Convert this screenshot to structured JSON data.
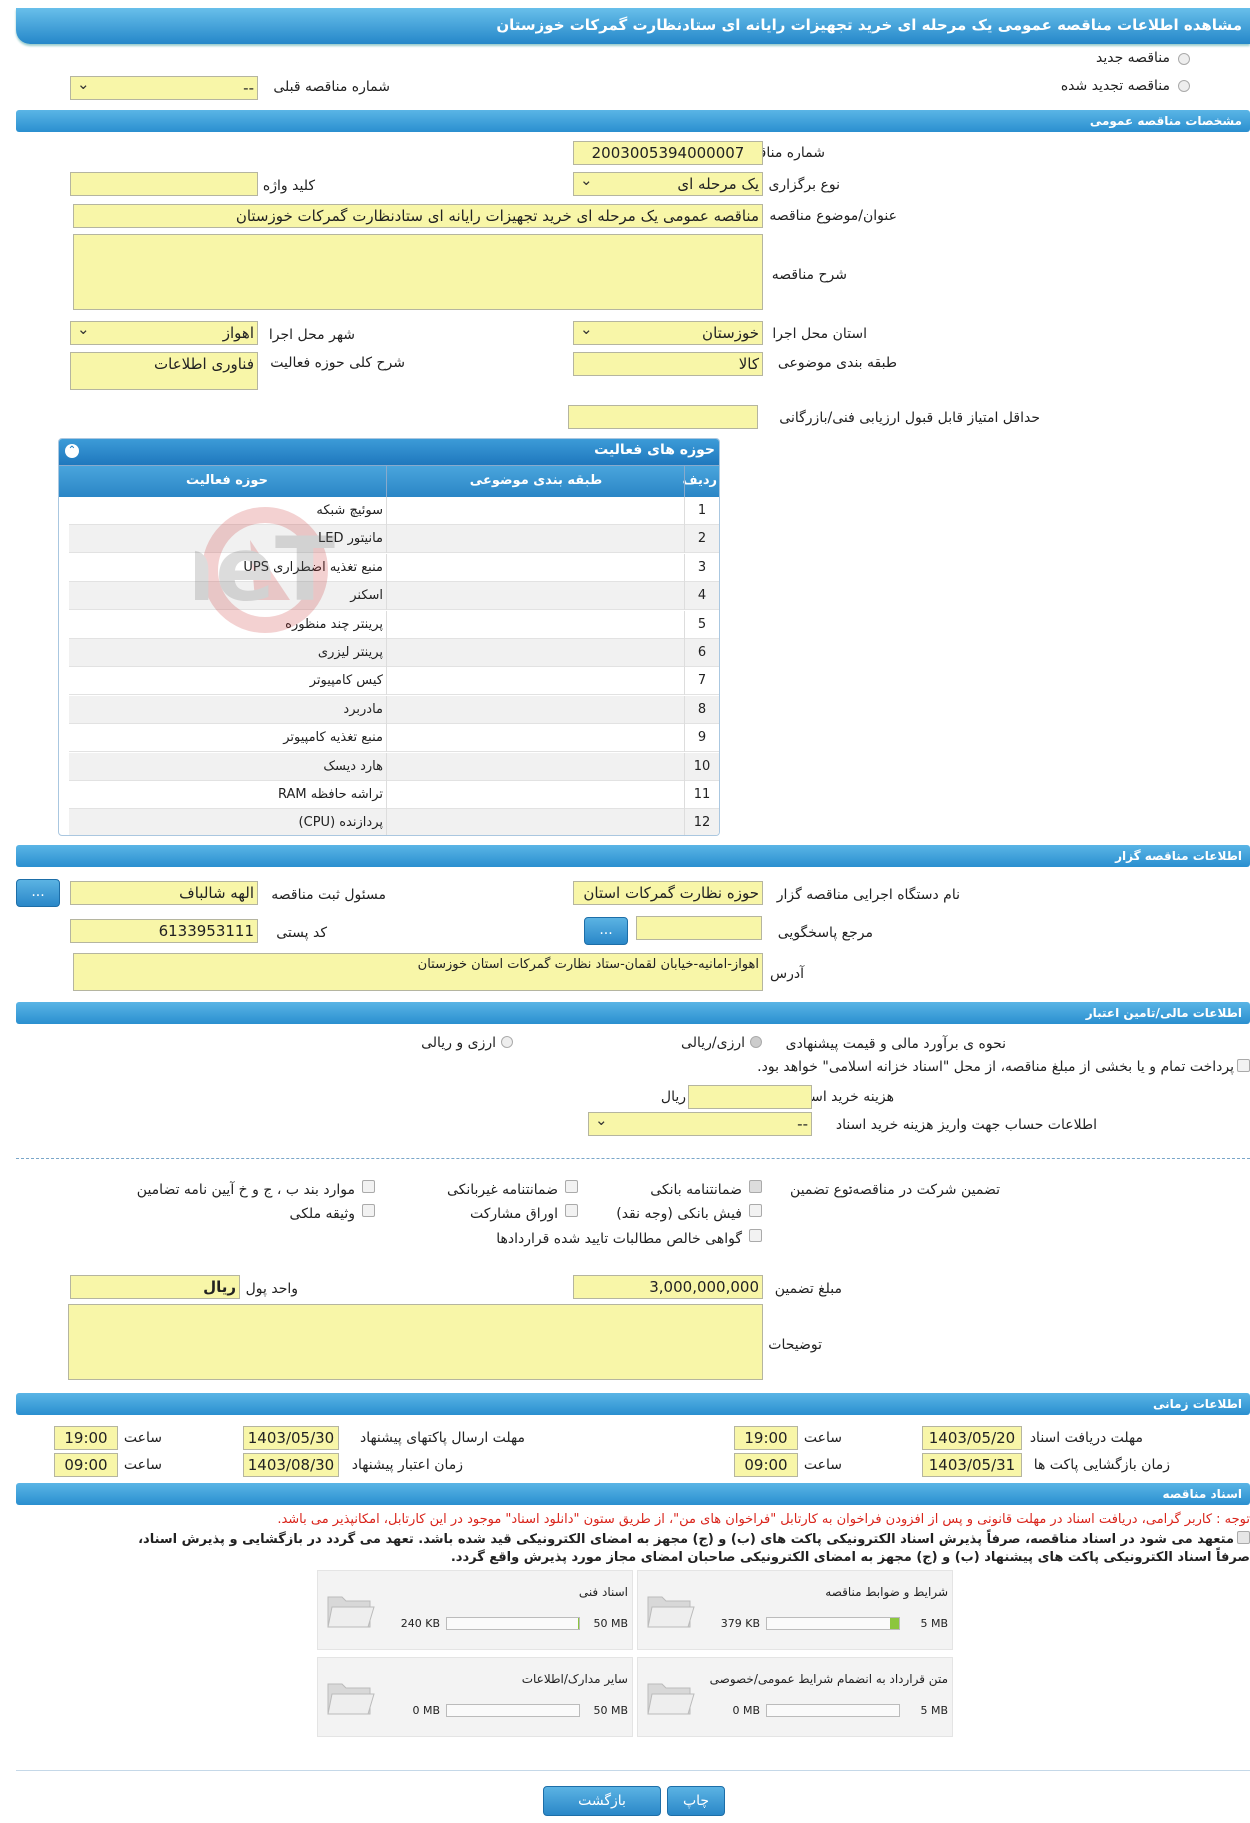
{
  "title": "مشاهده اطلاعات مناقصه عمومی یک مرحله ای خرید تجهیزات رایانه ای ستادنظارت گمرکات خوزستان",
  "top": {
    "new_tender": "مناقصه جدید",
    "renewed_tender": "مناقصه تجدید شده",
    "prev_number_label": "شماره مناقصه قبلی",
    "prev_number_value": "--"
  },
  "general": {
    "header": "مشخصات مناقصه عمومی",
    "number_label": "شماره مناقصه",
    "number": "2003005394000007",
    "type_label": "نوع برگزاری",
    "type": "یک مرحله ای",
    "keyword_label": "کلید واژه",
    "keyword": "",
    "subject_label": "عنوان/موضوع مناقصه",
    "subject": "مناقصه عمومی یک مرحله ای خرید تجهیزات رایانه ای ستادنظارت گمرکات خوزستان",
    "desc_label": "شرح مناقصه",
    "desc": "",
    "province_label": "استان محل اجرا",
    "province": "خوزستان",
    "city_label": "شهر محل اجرا",
    "city": "اهواز",
    "category_label": "طبقه بندی موضوعی",
    "category": "کالا",
    "scope_label": "شرح کلی حوزه فعالیت",
    "scope": "فناوری اطلاعات",
    "min_score_label": "حداقل امتیاز قابل قبول ارزیابی فنی/بازرگانی",
    "min_score": ""
  },
  "activities": {
    "header": "حوزه های فعالیت",
    "col_row": "ردیف",
    "col_cat": "طبقه بندی موضوعی",
    "col_area": "حوزه فعالیت",
    "rows": [
      {
        "n": "1",
        "area": "سوئیچ شبکه"
      },
      {
        "n": "2",
        "area": "مانیتور LED"
      },
      {
        "n": "3",
        "area": "منبع تغذیه اضطراری UPS"
      },
      {
        "n": "4",
        "area": "اسکنر"
      },
      {
        "n": "5",
        "area": "پرینتر چند منظوره"
      },
      {
        "n": "6",
        "area": "پرینتر لیزری"
      },
      {
        "n": "7",
        "area": "کیس کامپیوتر"
      },
      {
        "n": "8",
        "area": "مادربرد"
      },
      {
        "n": "9",
        "area": "منبع تغذیه کامپیوتر"
      },
      {
        "n": "10",
        "area": "هارد دیسک"
      },
      {
        "n": "11",
        "area": "تراشه حافظه RAM"
      },
      {
        "n": "12",
        "area": "پردازنده (CPU)"
      }
    ]
  },
  "organizer": {
    "header": "اطلاعات مناقصه گزار",
    "org_label": "نام دستگاه اجرایی مناقصه گزار",
    "org": "حوزه نظارت گمرکات استان",
    "resp_label": "مسئول ثبت مناقصه",
    "resp": "الهه شالباف",
    "ref_label": "مرجع پاسخگویی",
    "ref": "",
    "postal_label": "کد پستی",
    "postal": "6133953111",
    "addr_label": "آدرس",
    "addr": "اهواز-امانیه-خیابان لقمان-ستاد نظارت گمرکات استان خوزستان",
    "btn": "..."
  },
  "finance": {
    "header": "اطلاعات مالی/تامین اعتبار",
    "method_label": "نحوه ی برآورد مالی و قیمت پیشنهادی",
    "opt1": "ارزی/ریالی",
    "opt2": "ارزی و ریالی",
    "treasury": "پرداخت تمام و یا بخشی از مبلغ مناقصه، از محل \"اسناد خزانه اسلامی\" خواهد بود.",
    "doc_cost_label": "هزینه خرید اسناد",
    "doc_cost": "",
    "rial": "ریال",
    "account_label": "اطلاعات حساب جهت واریز هزینه خرید اسناد",
    "account": "--",
    "guarantee_label": "تضمین شرکت در مناقصه:",
    "gtype_label": "نوع تضمین",
    "g1": "ضمانتنامه بانکی",
    "g2": "ضمانتنامه غیربانکی",
    "g3": "موارد بند ب ، ج و خ آیین نامه تضامین",
    "g4": "فیش بانکی (وجه نقد)",
    "g5": "اوراق مشارکت",
    "g6": "وثیقه ملکی",
    "g7": "گواهی خالص مطالبات تایید شده قراردادها",
    "amount_label": "مبلغ تضمین",
    "amount": "3,000,000,000",
    "unit_label": "واحد پول",
    "unit": "ریال",
    "notes_label": "توضیحات",
    "notes": ""
  },
  "time": {
    "header": "اطلاعات زمانی",
    "recv_label": "مهلت دریافت اسناد",
    "recv_date": "1403/05/20",
    "recv_time": "19:00",
    "send_label": "مهلت ارسال پاکتهای پیشنهاد",
    "send_date": "1403/05/30",
    "send_time": "19:00",
    "open_label": "زمان بازگشایی پاکت ها",
    "open_date": "1403/05/31",
    "open_time": "09:00",
    "valid_label": "زمان اعتبار پیشنهاد",
    "valid_date": "1403/08/30",
    "valid_time": "09:00",
    "hour": "ساعت"
  },
  "docs": {
    "header": "اسناد مناقصه",
    "note": "توجه : کاربر گرامی، دریافت اسناد در مهلت قانونی و پس از افزودن فراخوان به کارتابل \"فراخوان های من\"، از طریق ستون \"دانلود اسناد\" موجود در این کارتابل، امکانپذیر می باشد.",
    "pledge1": "متعهد می شود در اسناد مناقصه، صرفاً پذیرش اسناد الکترونیکی پاکت های (ب) و (ج) مجهز به امضای الکترونیکی قید شده باشد. تعهد می گردد در بازگشایی و پذیرش اسناد،",
    "pledge2": "صرفاً اسناد الکترونیکی پاکت های پیشنهاد (ب) و (ج) مجهز به امضای الکترونیکی صاحبان امضای مجاز مورد پذیرش واقع گردد.",
    "cards": [
      {
        "name": "شرایط و ضوابط مناقصه",
        "size": "379 KB",
        "max": "5 MB",
        "fill": 0.07
      },
      {
        "name": "اسناد فنی",
        "size": "240 KB",
        "max": "50 MB",
        "fill": 0.005
      },
      {
        "name": "متن قرارداد به انضمام شرایط عمومی/خصوصی",
        "size": "0 MB",
        "max": "5 MB",
        "fill": 0
      },
      {
        "name": "سایر مدارک/اطلاعات",
        "size": "0 MB",
        "max": "50 MB",
        "fill": 0
      }
    ]
  },
  "buttons": {
    "print": "چاپ",
    "back": "بازگشت"
  },
  "watermark": "AriaTender.neT"
}
